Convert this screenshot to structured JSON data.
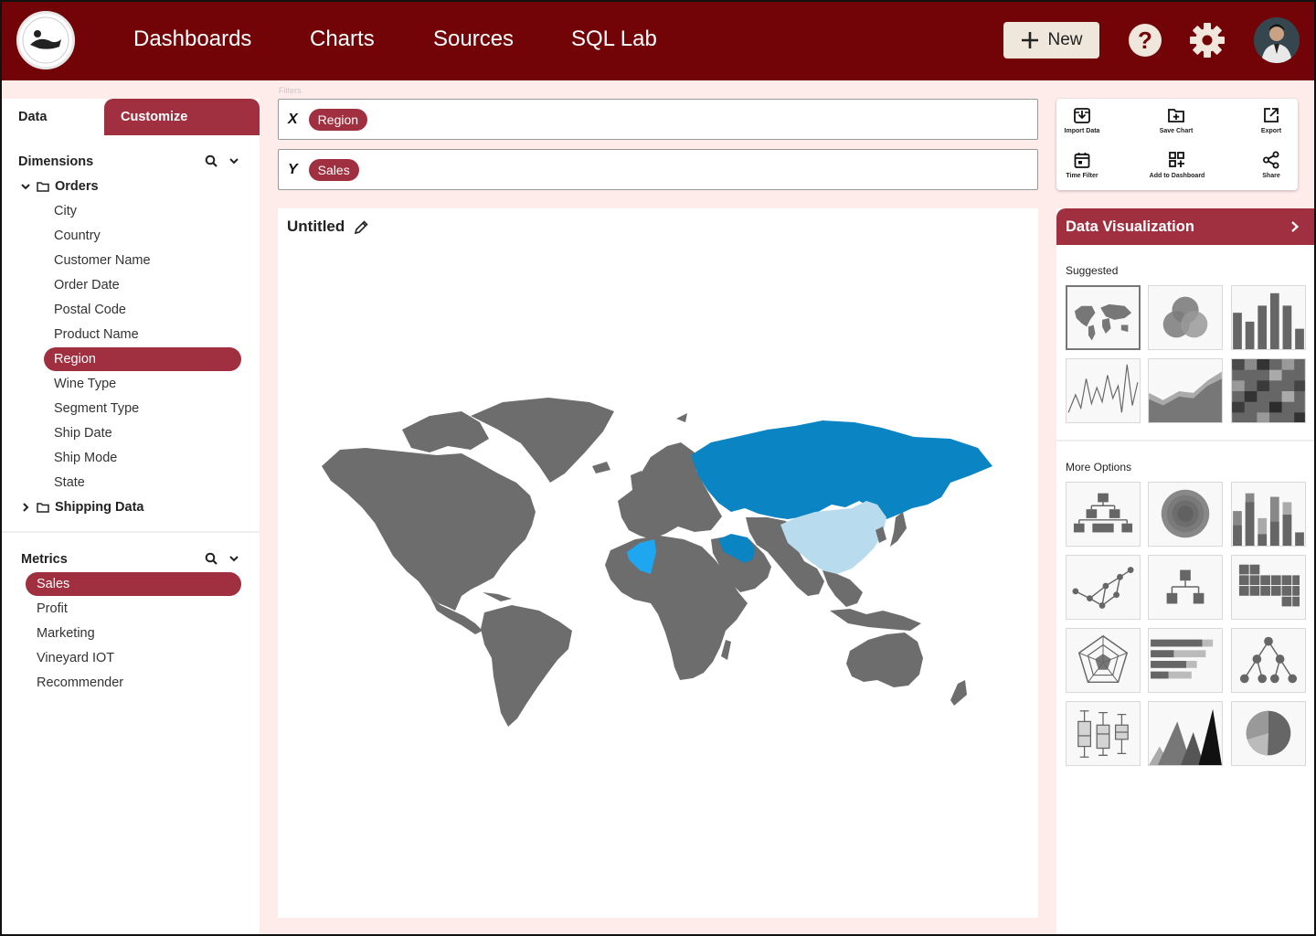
{
  "header": {
    "nav": [
      "Dashboards",
      "Charts",
      "Sources",
      "SQL Lab"
    ],
    "new_label": "New",
    "accent": "#720408"
  },
  "left": {
    "tabs": [
      "Data",
      "Customize"
    ],
    "dimensions_title": "Dimensions",
    "orders_label": "Orders",
    "order_fields": [
      "City",
      "Country",
      "Customer Name",
      "Order Date",
      "Postal Code",
      "Product Name",
      "Region",
      "Wine Type",
      "Segment Type",
      "Ship Date",
      "Ship Mode",
      "State"
    ],
    "selected_dimension": "Region",
    "shipping_label": "Shipping Data",
    "metrics_title": "Metrics",
    "metrics": [
      "Sales",
      "Profit",
      "Marketing",
      "Vineyard IOT",
      "Recommender"
    ],
    "selected_metric": "Sales"
  },
  "filters": {
    "label": "Filters",
    "x_letter": "X",
    "x_value": "Region",
    "y_letter": "Y",
    "y_value": "Sales"
  },
  "actions": [
    "Import Data",
    "Save Chart",
    "Export",
    "Time Filter",
    "Add to Dashboard",
    "Share"
  ],
  "chart": {
    "title": "Untitled",
    "highlight_colors": {
      "russia_iran": "#0a84c2",
      "algeria": "#1ea7f0",
      "china": "#b8dced",
      "land": "#6d6d6d"
    }
  },
  "viz_panel": {
    "title": "Data Visualization",
    "suggested_label": "Suggested",
    "more_label": "More Options",
    "suggested": [
      "world-map",
      "venn",
      "bar",
      "line",
      "area",
      "heatmap"
    ],
    "more": [
      "org-tree",
      "radial",
      "stacked-bar",
      "network",
      "hierarchy",
      "treemap",
      "radar",
      "horizontal-bar",
      "decision-tree",
      "box-plot",
      "mountain",
      "pie"
    ]
  }
}
